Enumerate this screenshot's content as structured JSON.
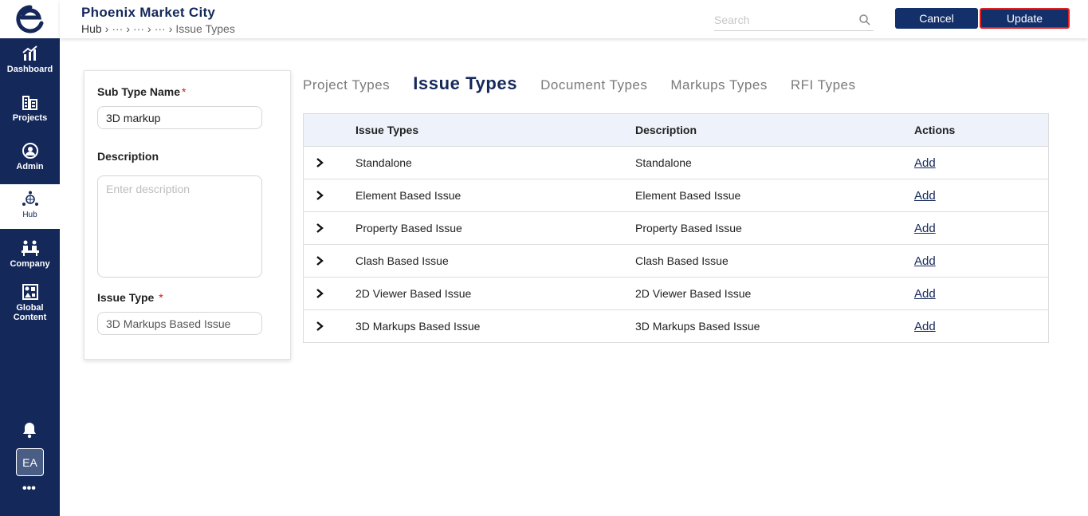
{
  "sidebar": {
    "items": [
      {
        "label": "Dashboard",
        "icon": "dashboard-icon"
      },
      {
        "label": "Projects",
        "icon": "projects-icon"
      },
      {
        "label": "Admin",
        "icon": "admin-icon"
      },
      {
        "label": "Hub",
        "icon": "hub-icon",
        "active": true
      },
      {
        "label": "Company",
        "icon": "company-icon"
      },
      {
        "label": "Global Content",
        "icon": "global-content-icon"
      }
    ],
    "avatar": "EA",
    "more": "•••"
  },
  "header": {
    "title": "Phoenix Market City",
    "breadcrumb": {
      "root": "Hub",
      "ellipsis": [
        "···",
        "···",
        "···"
      ],
      "current": "Issue Types",
      "separator": "›"
    },
    "search_placeholder": "Search",
    "cancel_label": "Cancel",
    "update_label": "Update"
  },
  "form": {
    "subtype_label": "Sub Type Name",
    "subtype_value": "3D markup",
    "description_label": "Description",
    "description_placeholder": "Enter description",
    "issue_type_label": "Issue Type",
    "issue_type_value": "3D Markups Based Issue",
    "required_mark": "*"
  },
  "tabs": [
    {
      "label": "Project Types",
      "active": false
    },
    {
      "label": "Issue Types",
      "active": true
    },
    {
      "label": "Document Types",
      "active": false
    },
    {
      "label": "Markups Types",
      "active": false
    },
    {
      "label": "RFI Types",
      "active": false
    }
  ],
  "table": {
    "headers": {
      "type": "Issue Types",
      "description": "Description",
      "actions": "Actions"
    },
    "rows": [
      {
        "type": "Standalone",
        "description": "Standalone",
        "action": "Add"
      },
      {
        "type": "Element Based Issue",
        "description": "Element Based Issue",
        "action": "Add"
      },
      {
        "type": "Property Based Issue",
        "description": "Property Based Issue",
        "action": "Add"
      },
      {
        "type": "Clash Based Issue",
        "description": "Clash Based Issue",
        "action": "Add"
      },
      {
        "type": "2D Viewer Based Issue",
        "description": "2D Viewer Based Issue",
        "action": "Add"
      },
      {
        "type": "3D Markups Based Issue",
        "description": "3D Markups Based Issue",
        "action": "Add"
      }
    ]
  },
  "colors": {
    "brand_navy": "#14285a",
    "button_navy": "#14306b",
    "highlight_red": "#e02020",
    "table_header_bg": "#eef3fb"
  }
}
